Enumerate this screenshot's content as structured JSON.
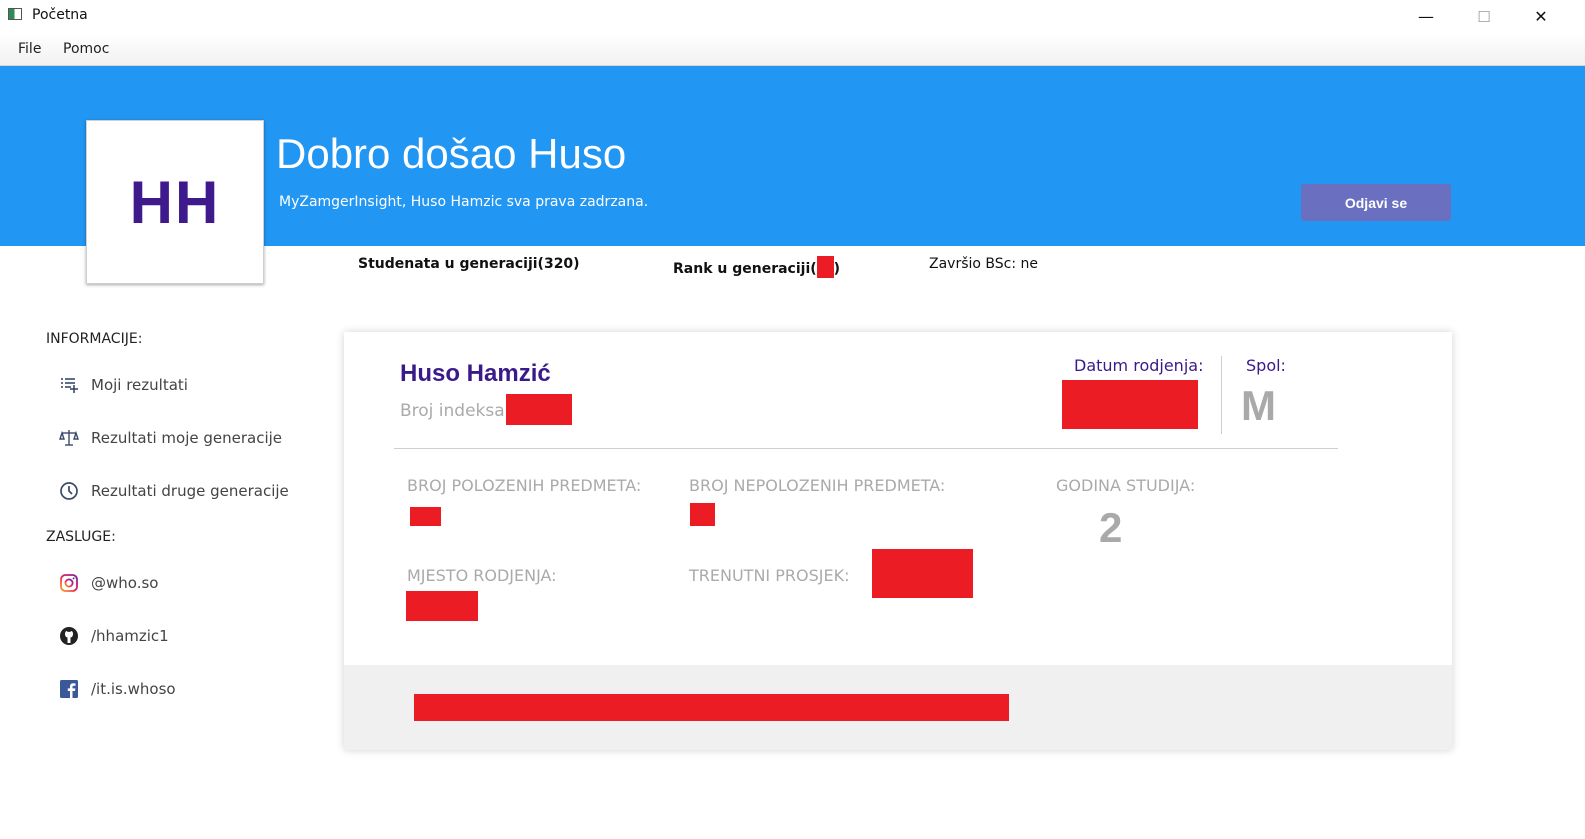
{
  "window": {
    "title": "Početna",
    "minimize_glyph": "—",
    "maximize_glyph": "☐",
    "close_glyph": "✕"
  },
  "menu": [
    "File",
    "Pomoc"
  ],
  "header": {
    "initials": "HH",
    "welcome": "Dobro došao Huso",
    "copyright": "MyZamgerInsight, Huso Hamzic sva prava zadrzana.",
    "logout_label": "Odjavi se",
    "banner_color": "#2196f3"
  },
  "stats": {
    "students_in_generation": "Studenata u generaciji(320)",
    "rank_prefix": "Rank u generaciji(",
    "rank_suffix": ")",
    "finished_bsc": "Završio BSc: ne"
  },
  "sidebar": {
    "info_title": "INFORMACIJE:",
    "info_items": [
      {
        "label": "Moji rezultati",
        "icon": "list-add-icon"
      },
      {
        "label": "Rezultati moje generacije",
        "icon": "scale-icon"
      },
      {
        "label": "Rezultati druge generacije",
        "icon": "clock-icon"
      }
    ],
    "credits_title": "ZASLUGE:",
    "credit_items": [
      {
        "label": "@who.so",
        "icon": "instagram-icon"
      },
      {
        "label": "/hhamzic1",
        "icon": "github-icon"
      },
      {
        "label": "/it.is.whoso",
        "icon": "facebook-icon"
      }
    ]
  },
  "card": {
    "name": "Huso Hamzić",
    "index_label": "Broj indeksa:",
    "dob_label": "Datum rodjenja:",
    "gender_label": "Spol:",
    "gender_value": "M",
    "passed_label": "BROJ POLOZENIH PREDMETA:",
    "failed_label": "BROJ NEPOLOZENIH PREDMETA:",
    "year_label": "GODINA STUDIJA:",
    "year_value": "2",
    "birthplace_label": "MJESTO RODJENJA:",
    "gpa_label": "TRENUTNI PROSJEK:"
  },
  "colors": {
    "accent": "#2196f3",
    "button": "#6a6fc0",
    "name": "#3a1a8a",
    "redaction": "#ec1c24"
  }
}
